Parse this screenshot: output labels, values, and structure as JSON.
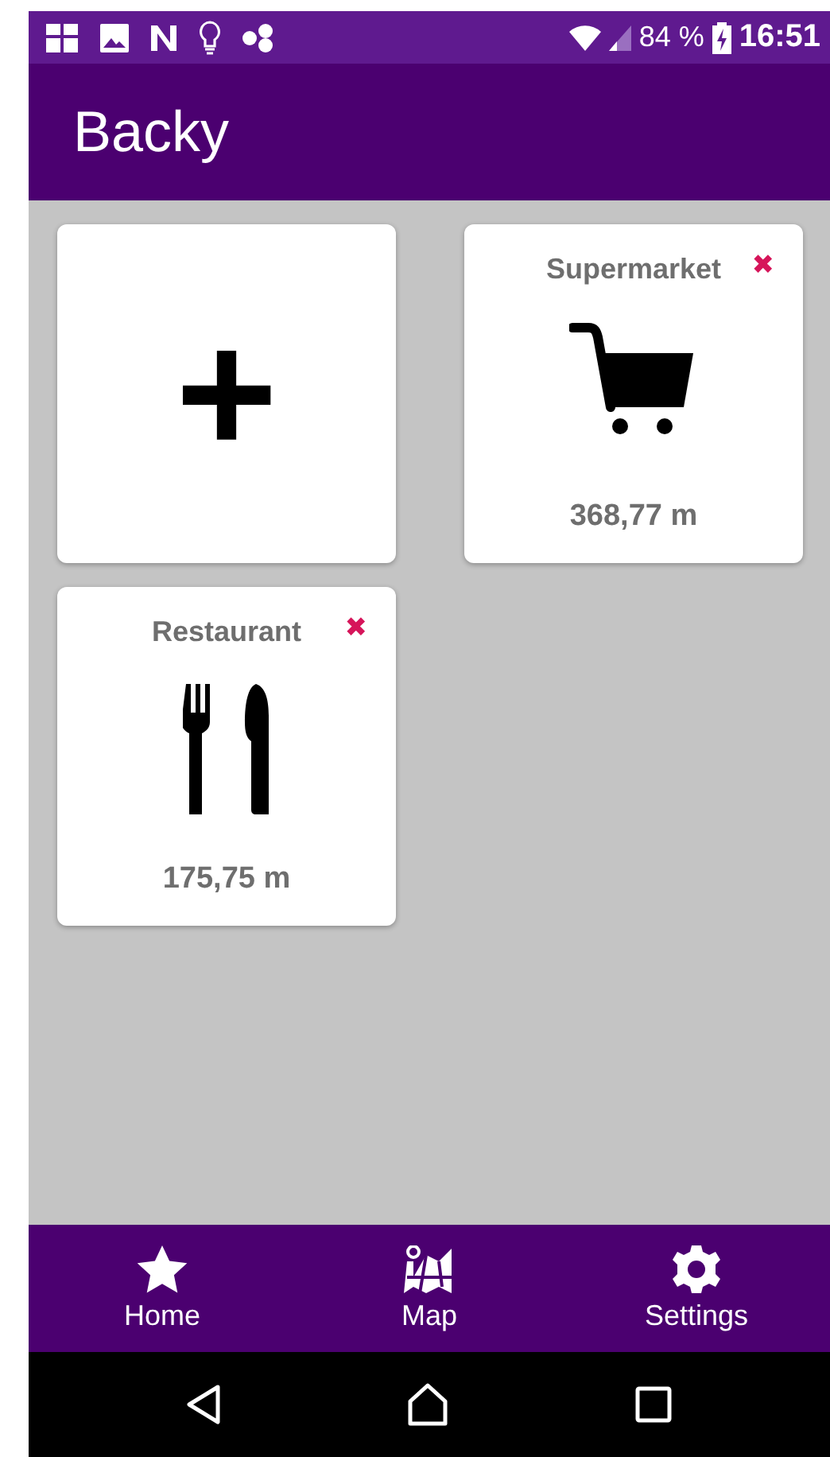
{
  "status_bar": {
    "battery": "84 %",
    "time": "16:51"
  },
  "app_bar": {
    "title": "Backy"
  },
  "cards": [
    {
      "kind": "add",
      "label": "+"
    },
    {
      "kind": "cart",
      "title": "Supermarket",
      "distance": "368,77 m",
      "delete": "✖"
    },
    {
      "kind": "cutlery",
      "title": "Restaurant",
      "distance": "175,75 m",
      "delete": "✖"
    }
  ],
  "bottom_nav": [
    {
      "kind": "star",
      "label": "Home"
    },
    {
      "kind": "map",
      "label": "Map"
    },
    {
      "kind": "gear",
      "label": "Settings"
    }
  ]
}
